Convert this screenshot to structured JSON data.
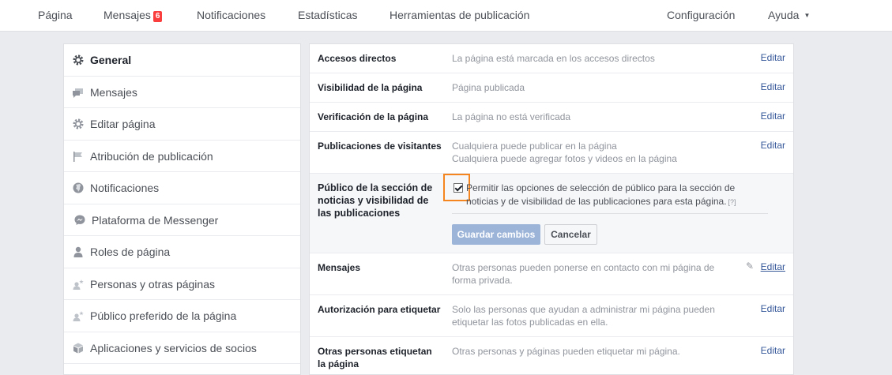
{
  "topnav": {
    "pagina": "Página",
    "mensajes": "Mensajes",
    "mensajes_badge": "6",
    "notificaciones": "Notificaciones",
    "estadisticas": "Estadísticas",
    "herramientas": "Herramientas de publicación",
    "configuracion": "Configuración",
    "ayuda": "Ayuda"
  },
  "sidebar": {
    "items": [
      {
        "label": "General",
        "icon": "gear-icon"
      },
      {
        "label": "Mensajes",
        "icon": "messages-icon"
      },
      {
        "label": "Editar página",
        "icon": "gear-icon"
      },
      {
        "label": "Atribución de publicación",
        "icon": "flag-icon"
      },
      {
        "label": "Notificaciones",
        "icon": "globe-icon"
      },
      {
        "label": "Plataforma de Messenger",
        "icon": "messenger-icon"
      },
      {
        "label": "Roles de página",
        "icon": "person-icon"
      },
      {
        "label": "Personas y otras páginas",
        "icon": "person-star-icon"
      },
      {
        "label": "Público preferido de la página",
        "icon": "person-star-icon"
      },
      {
        "label": "Aplicaciones y servicios de socios",
        "icon": "cube-icon"
      }
    ]
  },
  "settings": {
    "edit_label": "Editar",
    "rows": [
      {
        "name": "Accesos directos",
        "value": "La página está marcada en los accesos directos"
      },
      {
        "name": "Visibilidad de la página",
        "value": "Página publicada"
      },
      {
        "name": "Verificación de la página",
        "value": "La página no está verificada"
      },
      {
        "name": "Publicaciones de visitantes",
        "value": "Cualquiera puede publicar en la página",
        "value2": "Cualquiera puede agregar fotos y videos en la página"
      },
      {
        "name": "Público de la sección de noticias y visibilidad de las publicaciones",
        "checkbox_text": "Permitir las opciones de selección de público para la sección de noticias y de visibilidad de las publicaciones para esta página.",
        "help": "[?]",
        "save": "Guardar cambios",
        "cancel": "Cancelar"
      },
      {
        "name": "Mensajes",
        "value": "Otras personas pueden ponerse en contacto con mi página de forma privada."
      },
      {
        "name": "Autorización para etiquetar",
        "value": "Solo las personas que ayudan a administrar mi página pueden etiquetar las fotos publicadas en ella."
      },
      {
        "name": "Otras personas etiquetan la página",
        "value": "Otras personas y páginas pueden etiquetar mi página."
      }
    ]
  }
}
